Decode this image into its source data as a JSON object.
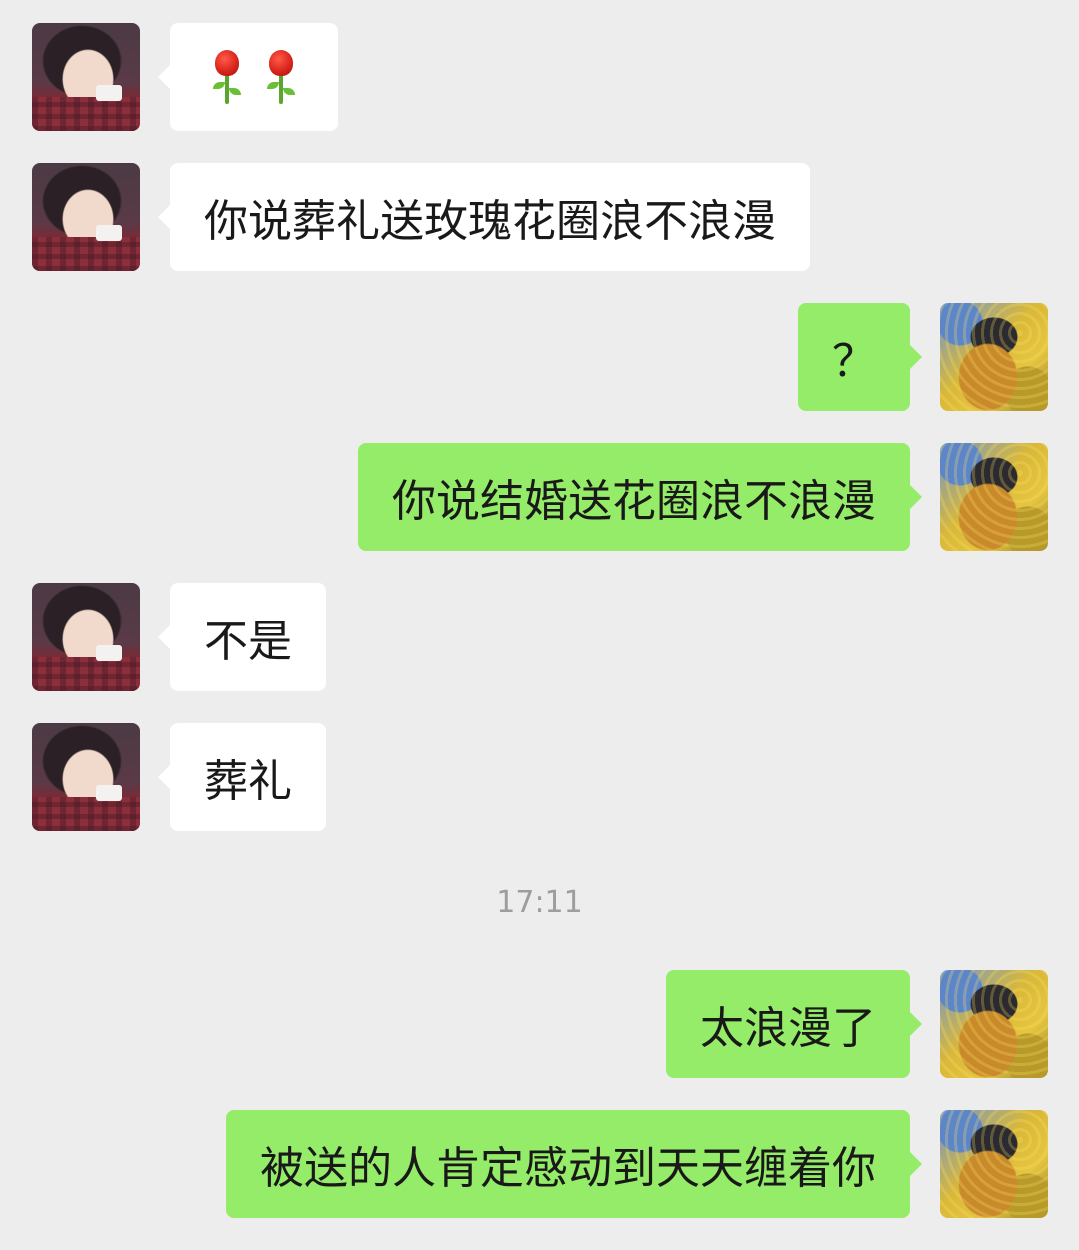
{
  "messages": [
    {
      "side": "left",
      "type": "emoji",
      "emoji": [
        "rose",
        "rose"
      ]
    },
    {
      "side": "left",
      "text": "你说葬礼送玫瑰花圈浪不浪漫"
    },
    {
      "side": "right",
      "text": "？"
    },
    {
      "side": "right",
      "text": "你说结婚送花圈浪不浪漫"
    },
    {
      "side": "left",
      "text": "不是"
    },
    {
      "side": "left",
      "text": "葬礼"
    },
    {
      "side": "right",
      "text": "太浪漫了"
    },
    {
      "side": "right",
      "text": "被送的人肯定感动到天天缠着你"
    }
  ],
  "timestamp": "17:11",
  "colors": {
    "background": "#ededed",
    "incoming_bubble": "#ffffff",
    "outgoing_bubble": "#95ec69",
    "text": "#191919",
    "timestamp": "#9d9d9d"
  }
}
